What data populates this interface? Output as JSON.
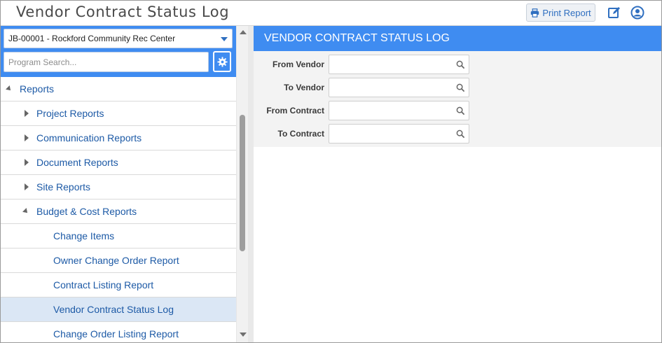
{
  "app": {
    "title": "Vendor Contract Status Log"
  },
  "toolbar": {
    "print_label": "Print Report",
    "icons": [
      "print-icon",
      "edit-icon",
      "user-icon"
    ]
  },
  "sidebar": {
    "project_selected": "JB-00001 - Rockford Community Rec Center",
    "search_placeholder": "Program Search...",
    "tree": {
      "root": "Reports",
      "items": [
        {
          "label": "Project Reports",
          "expanded": false,
          "level": 1
        },
        {
          "label": "Communication Reports",
          "expanded": false,
          "level": 1
        },
        {
          "label": "Document Reports",
          "expanded": false,
          "level": 1
        },
        {
          "label": "Site Reports",
          "expanded": false,
          "level": 1
        },
        {
          "label": "Budget & Cost Reports",
          "expanded": true,
          "level": 1
        },
        {
          "label": "Change Items",
          "level": 2
        },
        {
          "label": "Owner Change Order Report",
          "level": 2
        },
        {
          "label": "Contract Listing Report",
          "level": 2
        },
        {
          "label": "Vendor Contract Status Log",
          "level": 2,
          "selected": true
        },
        {
          "label": "Change Order Listing Report",
          "level": 2
        }
      ]
    }
  },
  "main": {
    "header": "VENDOR CONTRACT STATUS LOG",
    "fields": [
      {
        "label": "From Vendor",
        "value": ""
      },
      {
        "label": "To Vendor",
        "value": ""
      },
      {
        "label": "From Contract",
        "value": ""
      },
      {
        "label": "To Contract",
        "value": ""
      }
    ]
  },
  "colors": {
    "accent": "#3f8cf1",
    "link": "#1d5aa6",
    "selected_row": "#dbe7f5"
  }
}
